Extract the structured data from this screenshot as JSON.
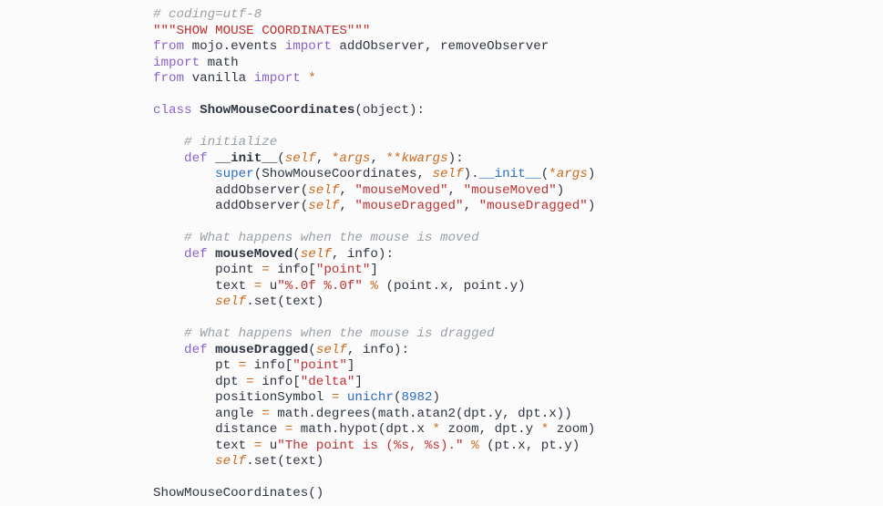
{
  "lines": {
    "l01_comment": "# coding=utf-8",
    "l02_doc": "\"\"\"SHOW MOUSE COORDINATES\"\"\"",
    "l03_from": "from",
    "l03_mod": " mojo.events ",
    "l03_import": "import",
    "l03_names": " addObserver, removeObserver",
    "l04_import": "import",
    "l04_mod": " math",
    "l05_from": "from",
    "l05_mod": " vanilla ",
    "l05_import": "import",
    "l05_star": " *",
    "l07_class": "class ",
    "l07_name": "ShowMouseCoordinates",
    "l07_tail": "(object):",
    "l09_comment": "    # initialize",
    "l10_def": "    def ",
    "l10_name": "__init__",
    "l10_open": "(",
    "l10_self": "self",
    "l10_c1": ", ",
    "l10_star1": "*",
    "l10_args": "args",
    "l10_c2": ", ",
    "l10_star2": "**",
    "l10_kwargs": "kwargs",
    "l10_close": "):",
    "l11_indent": "        ",
    "l11_super": "super",
    "l11_p1": "(ShowMouseCoordinates, ",
    "l11_self": "self",
    "l11_p2": ").",
    "l11_init": "__init__",
    "l11_p3": "(",
    "l11_star": "*",
    "l11_args": "args",
    "l11_p4": ")",
    "l12_indent": "        addObserver(",
    "l12_self": "self",
    "l12_c": ", ",
    "l12_s1": "\"mouseMoved\"",
    "l12_c2": ", ",
    "l12_s2": "\"mouseMoved\"",
    "l12_end": ")",
    "l13_indent": "        addObserver(",
    "l13_self": "self",
    "l13_c": ", ",
    "l13_s1": "\"mouseDragged\"",
    "l13_c2": ", ",
    "l13_s2": "\"mouseDragged\"",
    "l13_end": ")",
    "l15_comment": "    # What happens when the mouse is moved",
    "l16_def": "    def ",
    "l16_name": "mouseMoved",
    "l16_open": "(",
    "l16_self": "self",
    "l16_rest": ", info):",
    "l17_indent": "        point ",
    "l17_eq": "=",
    "l17_rest1": " info[",
    "l17_str": "\"point\"",
    "l17_rest2": "]",
    "l18_indent": "        text ",
    "l18_eq": "=",
    "l18_u": " u",
    "l18_str": "\"%.0f %.0f\"",
    "l18_pct": " % ",
    "l18_rest": "(point.x, point.y)",
    "l19_indent": "        ",
    "l19_self": "self",
    "l19_rest": ".set(text)",
    "l21_comment": "    # What happens when the mouse is dragged",
    "l22_def": "    def ",
    "l22_name": "mouseDragged",
    "l22_open": "(",
    "l22_self": "self",
    "l22_rest": ", info):",
    "l23_indent": "        pt ",
    "l23_eq": "=",
    "l23_rest1": " info[",
    "l23_str": "\"point\"",
    "l23_rest2": "]",
    "l24_indent": "        dpt ",
    "l24_eq": "=",
    "l24_rest1": " info[",
    "l24_str": "\"delta\"",
    "l24_rest2": "]",
    "l25_indent": "        positionSymbol ",
    "l25_eq": "=",
    "l25_sp": " ",
    "l25_fn": "unichr",
    "l25_open": "(",
    "l25_num": "8982",
    "l25_close": ")",
    "l26_indent": "        angle ",
    "l26_eq": "=",
    "l26_rest": " math.degrees(math.atan2(dpt.y, dpt.x))",
    "l27_indent": "        distance ",
    "l27_eq": "=",
    "l27_a": " math.hypot(dpt.x ",
    "l27_s1": "*",
    "l27_b": " zoom, dpt.y ",
    "l27_s2": "*",
    "l27_c": " zoom)",
    "l28_indent": "        text ",
    "l28_eq": "=",
    "l28_u": " u",
    "l28_str": "\"The point is (%s, %s).\"",
    "l28_pct": " % ",
    "l28_rest": "(pt.x, pt.y)",
    "l29_indent": "        ",
    "l29_self": "self",
    "l29_rest": ".set(text)",
    "l31_call": "ShowMouseCoordinates()"
  }
}
